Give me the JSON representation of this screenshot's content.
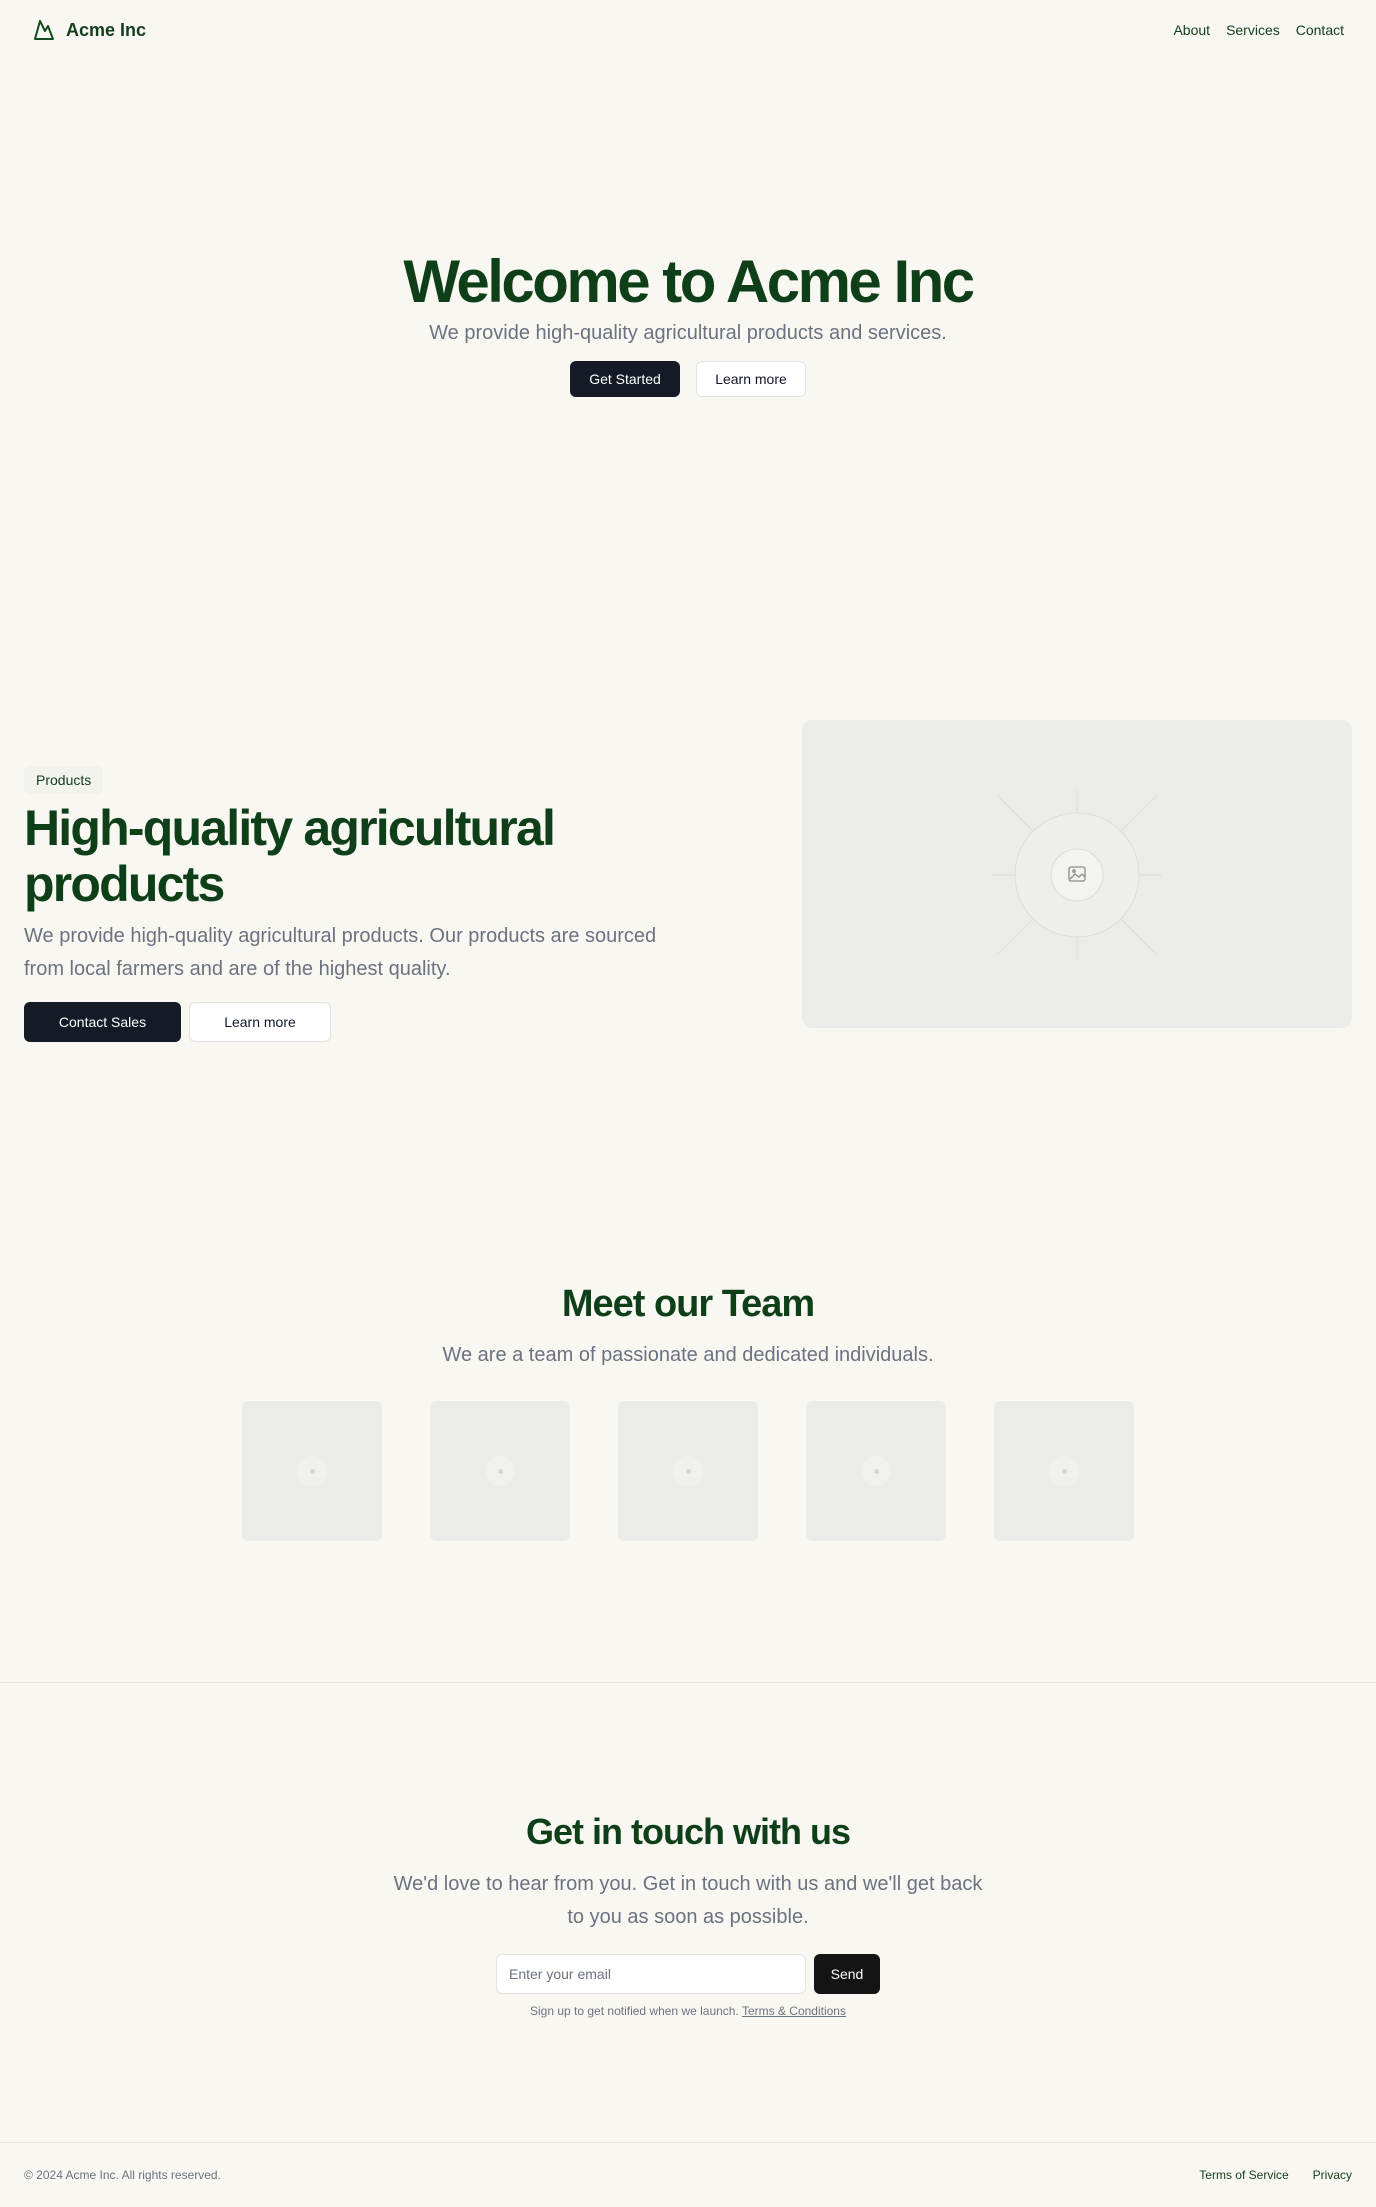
{
  "header": {
    "brand": "Acme Inc",
    "logo_icon": "mountain-icon",
    "nav": [
      {
        "label": "About"
      },
      {
        "label": "Services"
      },
      {
        "label": "Contact"
      }
    ]
  },
  "hero": {
    "title": "Welcome to Acme Inc",
    "subtitle": "We provide high-quality agricultural products and services.",
    "primary_button": "Get Started",
    "secondary_button": "Learn more"
  },
  "products": {
    "badge": "Products",
    "title": "High-quality agricultural products",
    "description": "We provide high-quality agricultural products. Our products are sourced from local farmers and are of the highest quality.",
    "primary_button": "Contact Sales",
    "secondary_button": "Learn more",
    "image_icon": "image-placeholder-icon"
  },
  "team": {
    "title": "Meet our Team",
    "subtitle": "We are a team of passionate and dedicated individuals.",
    "member_count_shown": 5
  },
  "contact": {
    "title": "Get in touch with us",
    "subtitle": "We'd love to hear from you. Get in touch with us and we'll get back to you as soon as possible.",
    "email_placeholder": "Enter your email",
    "send_button": "Send",
    "fine_print": "Sign up to get notified when we launch.",
    "terms_link": "Terms & Conditions"
  },
  "footer": {
    "copyright": "© 2024 Acme Inc. All rights reserved.",
    "links": [
      {
        "label": "Terms of Service"
      },
      {
        "label": "Privacy"
      }
    ]
  },
  "colors": {
    "background": "#f9f7f2",
    "heading_green": "#0e3f18",
    "dark_button": "#141a26",
    "muted_text": "#6b7280",
    "placeholder_gray": "#ebebea"
  }
}
